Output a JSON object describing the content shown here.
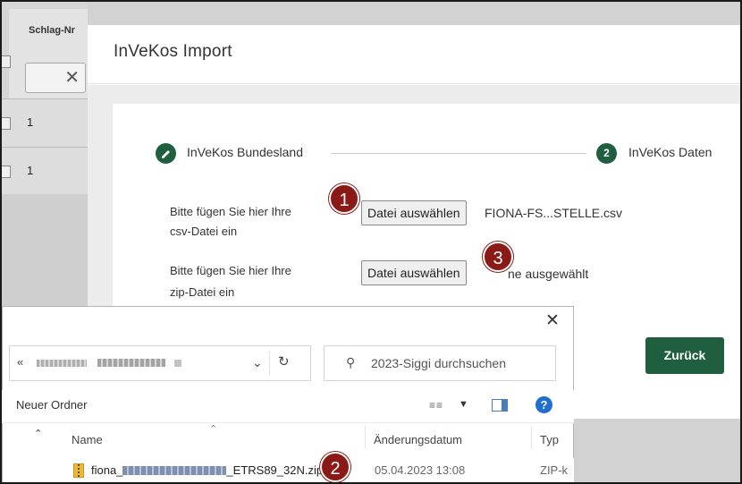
{
  "background": {
    "column_title": "Schlag-Nr",
    "filter_clear": "✕",
    "rows": [
      "1",
      "1"
    ]
  },
  "dialog": {
    "title": "InVeKos Import",
    "steps": [
      {
        "label": "InVeKos Bundesland",
        "state": "done"
      },
      {
        "number": "2",
        "label": "InVeKos Daten",
        "state": "active"
      }
    ],
    "csv": {
      "label_line1": "Bitte fügen Sie hier Ihre",
      "label_line2": "csv-Datei ein",
      "button": "Datei auswählen",
      "file_name": "FIONA-FS...STELLE.csv"
    },
    "zip": {
      "label_line1": "Bitte fügen Sie hier Ihre",
      "label_line2": "zip-Datei ein",
      "button": "Datei auswählen",
      "file_name": "ne ausgewählt"
    },
    "back_button": "Zurück",
    "accent_color": "#1f5f3f"
  },
  "annotations": {
    "badge1": "1",
    "badge2": "2",
    "badge3": "3",
    "color": "#8b1a17"
  },
  "file_dialog": {
    "close": "✕",
    "path_prefix": "«",
    "search_placeholder": "2023-Siggi durchsuchen",
    "new_folder": "Neuer Ordner",
    "help": "?",
    "columns": {
      "name": "Name",
      "date": "Änderungsdatum",
      "type": "Typ"
    },
    "file": {
      "name_prefix": "fiona_",
      "name_suffix": "_ETRS89_32N.zip",
      "date": "05.04.2023 13:08",
      "type": "ZIP-k"
    }
  }
}
